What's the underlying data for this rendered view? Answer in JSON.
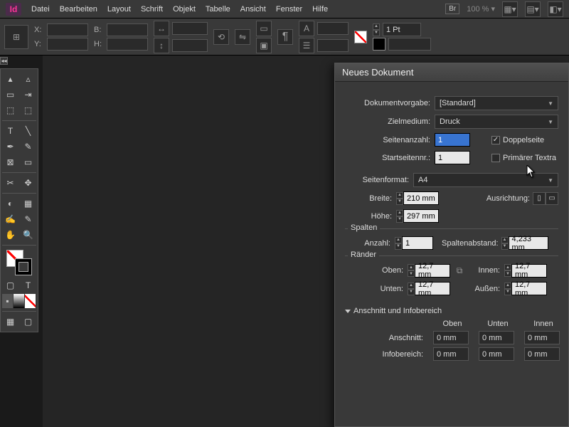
{
  "app": {
    "id": "Id"
  },
  "menu": [
    "Datei",
    "Bearbeiten",
    "Layout",
    "Schrift",
    "Objekt",
    "Tabelle",
    "Ansicht",
    "Fenster",
    "Hilfe"
  ],
  "menuright": {
    "br": "Br",
    "zoom": "100 %"
  },
  "ctrl": {
    "x": "X:",
    "y": "Y:",
    "b": "B:",
    "h": "H:",
    "stroke_weight": "1 Pt"
  },
  "dialog": {
    "title": "Neues Dokument",
    "preset_label": "Dokumentvorgabe:",
    "preset_value": "[Standard]",
    "intent_label": "Zielmedium:",
    "intent_value": "Druck",
    "pages_label": "Seitenanzahl:",
    "pages_value": "1",
    "facing_label": "Doppelseite",
    "startpg_label": "Startseitennr.:",
    "startpg_value": "1",
    "primary_label": "Primärer Textra",
    "pagesize_label": "Seitenformat:",
    "pagesize_value": "A4",
    "width_label": "Breite:",
    "width_value": "210 mm",
    "height_label": "Höhe:",
    "height_value": "297 mm",
    "orient_label": "Ausrichtung:",
    "cols_legend": "Spalten",
    "colnum_label": "Anzahl:",
    "colnum_value": "1",
    "gutter_label": "Spaltenabstand:",
    "gutter_value": "4,233 mm",
    "margins_legend": "Ränder",
    "top_label": "Oben:",
    "bottom_label": "Unten:",
    "inside_label": "Innen:",
    "outside_label": "Außen:",
    "margin_value": "12,7 mm",
    "bleed_legend": "Anschnitt und Infobereich",
    "hdr_top": "Oben",
    "hdr_bottom": "Unten",
    "hdr_inside": "Innen",
    "bleed_label": "Anschnitt:",
    "slug_label": "Infobereich:",
    "zero": "0 mm"
  }
}
